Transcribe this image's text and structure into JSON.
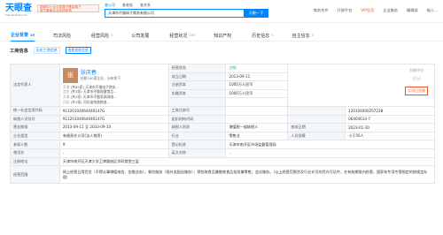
{
  "header": {
    "brand": "天眼查",
    "brand_url": "TianYanCha.com",
    "banner_line1": "国家中小企业发展子基金旗下",
    "banner_line2": "官方备案企业征信机构",
    "search_tabs": [
      "查公司",
      "查老板",
      "查关系"
    ],
    "search_value": "天津市不猫网子商务有限公司",
    "search_button": "天眼一下",
    "links": [
      "商务合作",
      "开放平台",
      "VIP会员",
      "企业服务",
      "编辑部",
      "喵人..."
    ],
    "vip_color": "#e8542b"
  },
  "tabs": [
    {
      "label": "企业背景",
      "count": "19"
    },
    {
      "label": "司法风险",
      "count": ""
    },
    {
      "label": "经营风险",
      "count": "0"
    },
    {
      "label": "公司发展",
      "count": ""
    },
    {
      "label": "经营状况",
      "count": "150"
    },
    {
      "label": "知识产权",
      "count": ""
    },
    {
      "label": "历史信息",
      "count": "5"
    },
    {
      "label": "自主信息",
      "count": "0"
    }
  ],
  "section": {
    "title": "工商信息",
    "history": "历史工商信息",
    "button": "查看变更信息"
  },
  "legal": {
    "label": "法定代表人",
    "avatar": "张",
    "name": "张庆春",
    "desc": "任职100家企业，分布如下",
    "list": [
      {
        "tag": "天津",
        "n": "(共85家)",
        "item": "天津市不猫电子商务..."
      },
      {
        "tag": "北京",
        "n": "(共3家)",
        "item": "天津市不猫保健食品..."
      },
      {
        "tag": "天津",
        "n": "(共2家)",
        "item": "天津市不猫家具网络..."
      },
      {
        "tag": "河北",
        "n": "(共1家)",
        "item": "河北省快递物流..."
      }
    ]
  },
  "score": {
    "title": "天眼评分",
    "value": "评分",
    "tag": "公司已注销"
  },
  "rows": {
    "status_label": "经营状态",
    "status": "注销",
    "found_label": "成立日期",
    "found": "2013-09-11",
    "reg_cap_label": "注册资本",
    "reg_cap": "1000万人民币",
    "paid_cap_label": "实缴资本",
    "paid_cap": "1000万人民币",
    "credit_label": "统一社会信用代码",
    "credit": "91120104064046147G",
    "biz_no_label": "工商注册号",
    "biz_no": "120104000257238",
    "tax_label": "纳税人识别号",
    "tax": "91120104064046147G",
    "org_label": "组织机构代码",
    "org": "06404614-7",
    "term_label": "营业期限",
    "term": "2013-09-11 至 2033-09-10",
    "taxpayer_label": "纳税人资质",
    "taxpayer": "增值税一般纳税人",
    "approve_label": "核准日期",
    "approve": "2023-01-30",
    "type_label": "企业类型",
    "type": "有限责任公司(法人独资)",
    "industry_label": "行业",
    "industry": "零售业",
    "staff_label": "人员规模",
    "staff": "小于50人",
    "insured_label": "参保人数",
    "insured": "9",
    "authority_label": "登记机关",
    "authority": "天津市南开区市场监督管理局",
    "used_name_label": "曾用名",
    "used_name": "-",
    "en_name_label": "英文名称",
    "en_name": "-",
    "address_label": "注册地址",
    "address": "天津市南开区天津大学卫津路校区学四食堂三层",
    "scope_label": "经营范围",
    "scope": "网上经营日用百货（不得从事增值电信、金融业务）；餐饮服务（限外卖配送服务）；预包装食品兼散装食品批发兼零售；会议服务。（以上经营范围涉及行业许可的凭许可证件，在有效期限内经营，国家有专项专营规定的按规定办理）"
  }
}
